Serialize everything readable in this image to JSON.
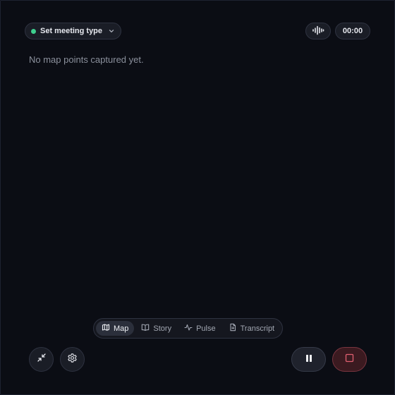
{
  "header": {
    "meeting_type_label": "Set meeting type",
    "status_color": "#3ecf8e",
    "timer": "00:00",
    "audio_icon": "audio-waveform-icon"
  },
  "main": {
    "empty_message": "No map points captured yet."
  },
  "view_tabs": [
    {
      "label": "Map",
      "icon": "map-icon",
      "active": true
    },
    {
      "label": "Story",
      "icon": "book-open-icon",
      "active": false
    },
    {
      "label": "Pulse",
      "icon": "activity-icon",
      "active": false
    },
    {
      "label": "Transcript",
      "icon": "document-icon",
      "active": false
    }
  ],
  "controls": {
    "minimize_icon": "minimize-icon",
    "settings_icon": "gear-icon",
    "pause_icon": "pause-icon",
    "stop_icon": "stop-icon",
    "stop_accent": "#e06070"
  }
}
